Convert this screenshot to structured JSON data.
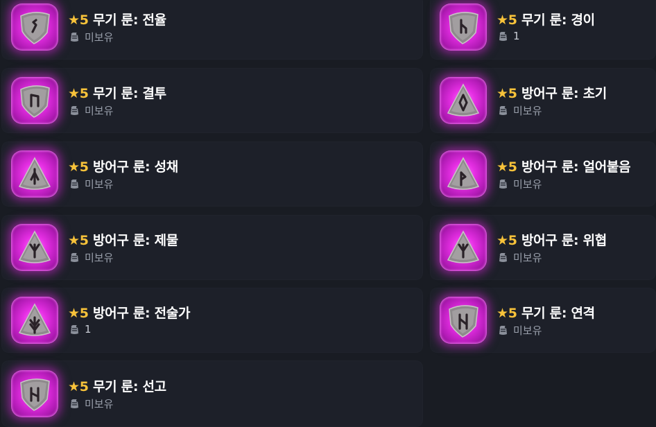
{
  "colors": {
    "star": "#f7c23a",
    "glow": "#e52ee3",
    "card": "#1d2029",
    "background": "#191c23"
  },
  "grade_label": "★5",
  "left_column": [
    {
      "name": "무기 룬: 전율",
      "status": "미보유",
      "icon": "rune-shield-icon"
    },
    {
      "name": "무기 룬: 결투",
      "status": "미보유",
      "icon": "rune-shield-icon"
    },
    {
      "name": "방어구 룬: 성채",
      "status": "미보유",
      "icon": "rune-triangle-icon"
    },
    {
      "name": "방어구 룬: 제물",
      "status": "미보유",
      "icon": "rune-triangle-icon"
    },
    {
      "name": "방어구 룬: 전술가",
      "status": "1",
      "icon": "rune-triangle-icon"
    },
    {
      "name": "무기 룬: 선고",
      "status": "미보유",
      "icon": "rune-shield-icon"
    }
  ],
  "right_column": [
    {
      "name": "무기 룬: 경이",
      "status": "1",
      "icon": "rune-shield-icon"
    },
    {
      "name": "방어구 룬: 초기",
      "status": "미보유",
      "icon": "rune-triangle-icon"
    },
    {
      "name": "방어구 룬: 얼어붙음",
      "status": "미보유",
      "icon": "rune-triangle-icon"
    },
    {
      "name": "방어구 룬: 위협",
      "status": "미보유",
      "icon": "rune-triangle-icon"
    },
    {
      "name": "무기 룬: 연격",
      "status": "미보유",
      "icon": "rune-shield-icon"
    }
  ]
}
